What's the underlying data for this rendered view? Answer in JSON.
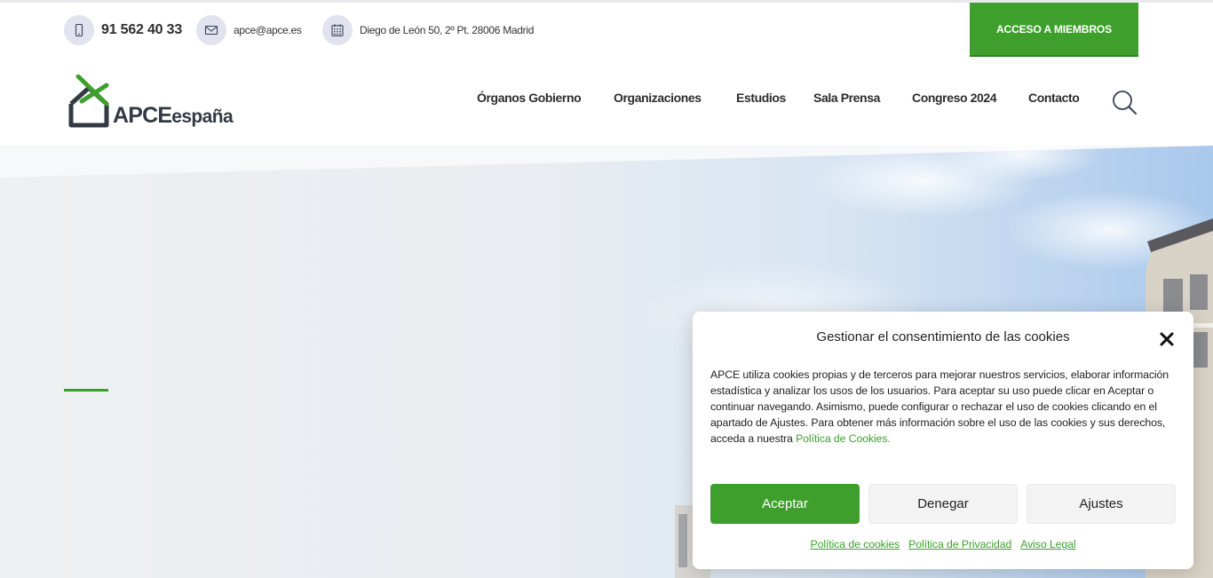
{
  "topbar": {
    "phone": "91 562 40 33",
    "email": "apce@apce.es",
    "address": "Diego de León 50, 2º Pt. 28006 Madrid",
    "members_button": "ACCESO A MIEMBROS",
    "icons": [
      "phone-icon",
      "mail-icon",
      "calendar-icon"
    ]
  },
  "header": {
    "logo": {
      "big": "APCE",
      "small": "españa"
    },
    "nav": [
      {
        "label": "Órganos Gobierno"
      },
      {
        "label": "Organizaciones"
      },
      {
        "label": "Estudios"
      },
      {
        "label": "Sala Prensa"
      },
      {
        "label": "Congreso 2024"
      },
      {
        "label": "Contacto"
      }
    ],
    "search_icon": "search-icon"
  },
  "cookie": {
    "title": "Gestionar el consentimiento de las cookies",
    "body": "APCE utiliza cookies propias y de terceros para mejorar nuestros servicios, elaborar información estadística y analizar los usos de los usuarios. Para aceptar su uso puede clicar en Aceptar o continuar navegando. Asimismo, puede configurar o rechazar el uso de cookies clicando en el apartado de Ajustes. Para obtener más información sobre el uso de las cookies y sus derechos, acceda a nuestra ",
    "body_link": "Política de Cookies.",
    "accept": "Aceptar",
    "deny": "Denegar",
    "settings": "Ajustes",
    "links": [
      "Política de cookies",
      "Política de Privacidad",
      "Aviso Legal"
    ]
  },
  "colors": {
    "brand_green": "#3f9f2d",
    "dark_text": "#333a44",
    "icon_circle": "#e1e4ee"
  }
}
